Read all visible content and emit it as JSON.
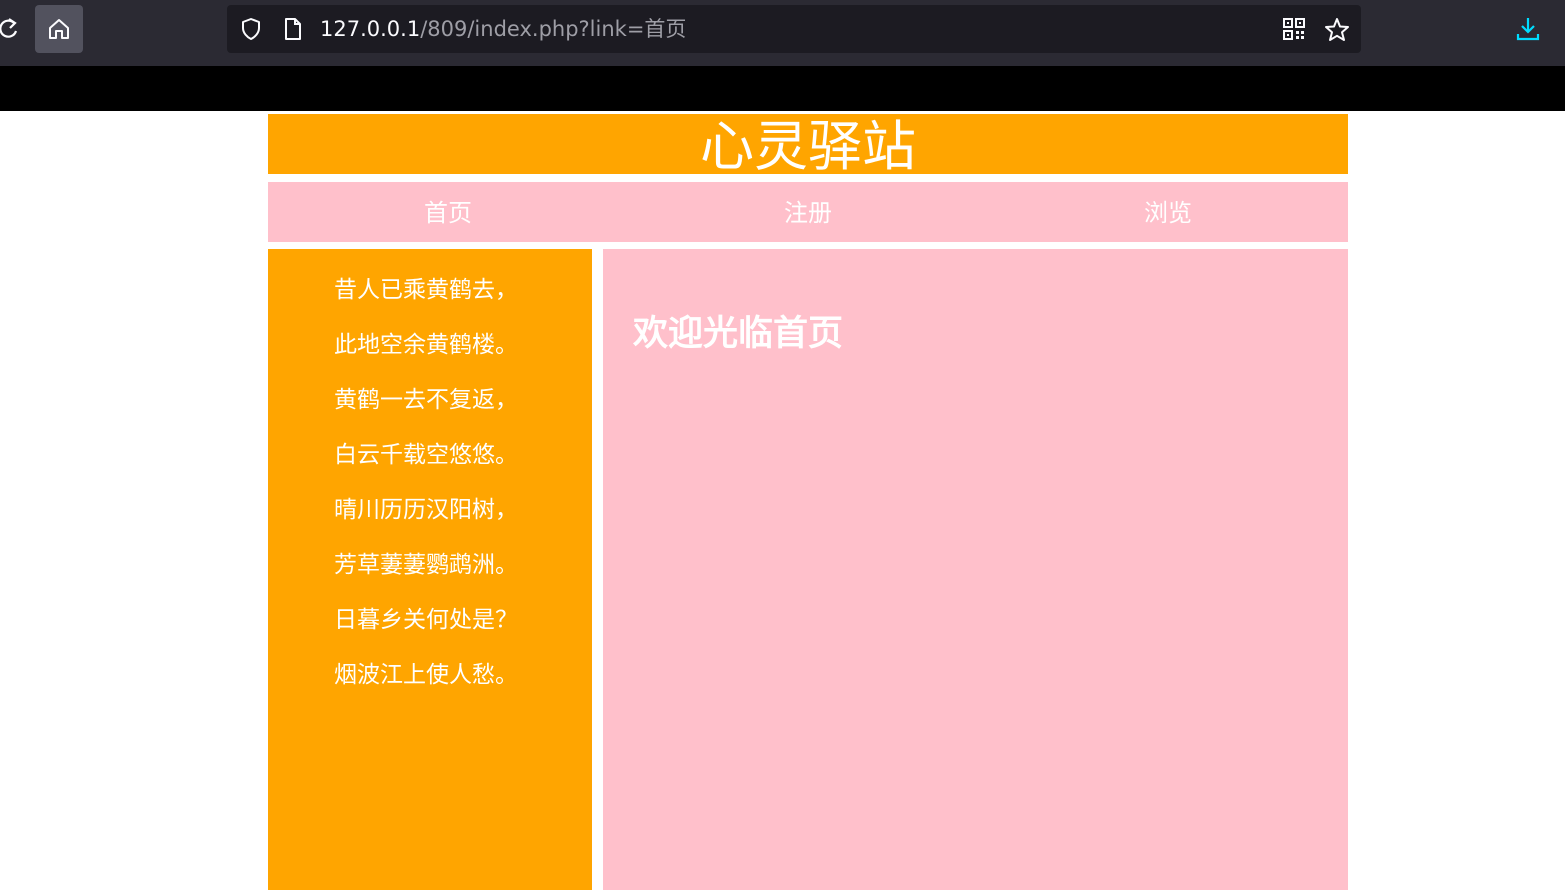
{
  "browser": {
    "url_host": "127.0.0.1",
    "url_path": "/809/index.php?link=首页",
    "icons": {
      "reload": "reload-icon",
      "home": "home-icon",
      "shield": "shield-icon",
      "page": "page-icon",
      "qr": "qr-code-icon",
      "bookmark": "star-icon",
      "download": "download-icon"
    },
    "colors": {
      "toolbar": "#2b2a33",
      "urlbar": "#1c1b22",
      "download_accent": "#00ddff"
    }
  },
  "site": {
    "title": "心灵驿站",
    "nav": [
      {
        "label": "首页"
      },
      {
        "label": "注册"
      },
      {
        "label": "浏览"
      }
    ],
    "poem_lines": [
      "昔人已乘黄鹤去，",
      "此地空余黄鹤楼。",
      "黄鹤一去不复返，",
      "白云千载空悠悠。",
      "晴川历历汉阳树，",
      "芳草萋萋鹦鹉洲。",
      "日暮乡关何处是？",
      "烟波江上使人愁。"
    ],
    "welcome": "欢迎光临首页",
    "colors": {
      "header": "#ffa500",
      "nav": "#ffc0cb",
      "sidebar": "#ffa500",
      "main": "#ffc0cb",
      "text": "#ffffff"
    }
  }
}
